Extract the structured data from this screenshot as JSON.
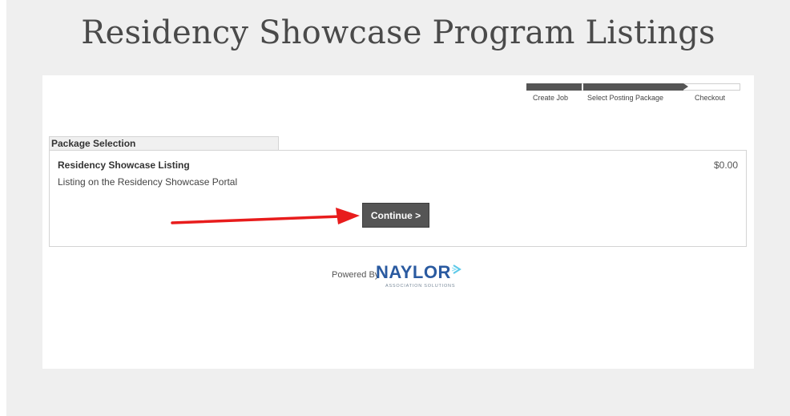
{
  "page": {
    "title": "Residency Showcase Program Listings"
  },
  "progress": {
    "steps": [
      {
        "label": "Create Job"
      },
      {
        "label": "Select Posting Package"
      },
      {
        "label": "Checkout"
      }
    ]
  },
  "package_section": {
    "tab_label": "Package Selection",
    "package": {
      "name": "Residency Showcase Listing",
      "description": "Listing on the Residency Showcase Portal",
      "price": "$0.00"
    },
    "continue_label": "Continue >"
  },
  "footer": {
    "powered_by": "Powered By",
    "logo_text": "NAYLOR",
    "logo_tagline": "ASSOCIATION SOLUTIONS"
  },
  "colors": {
    "button_bg": "#555555",
    "arrow": "#e81c1c",
    "logo_blue": "#2a5aa0",
    "logo_accent": "#5bc8e8"
  },
  "icons": {
    "annotation": "red-arrow-icon",
    "logo_mark": "chevron-right-icon"
  }
}
